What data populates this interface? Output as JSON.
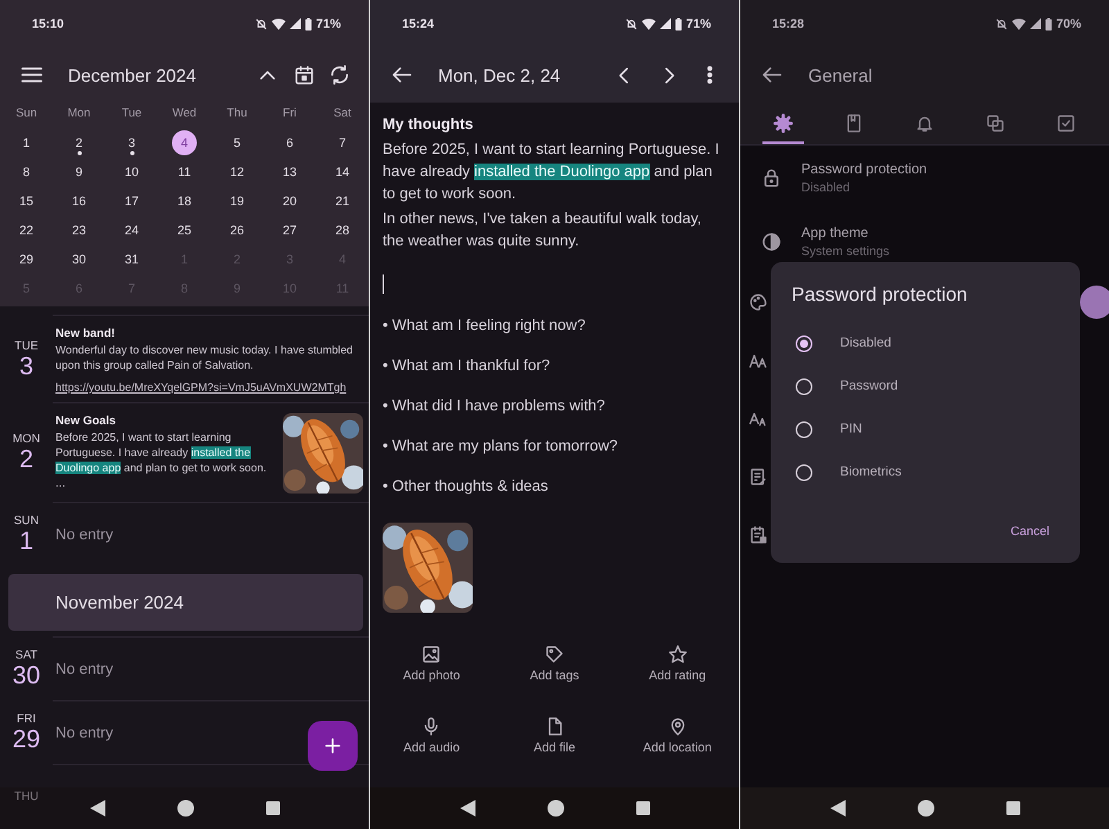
{
  "calendar_screen": {
    "status_bar": {
      "time": "15:10",
      "battery": "71%"
    },
    "title": "December 2024",
    "weekdays": [
      "Sun",
      "Mon",
      "Tue",
      "Wed",
      "Thu",
      "Fri",
      "Sat"
    ],
    "weeks": [
      [
        {
          "day": "1",
          "in_month": true,
          "selected": false,
          "has_entry": false
        },
        {
          "day": "2",
          "in_month": true,
          "selected": false,
          "has_entry": true
        },
        {
          "day": "3",
          "in_month": true,
          "selected": false,
          "has_entry": true
        },
        {
          "day": "4",
          "in_month": true,
          "selected": true,
          "has_entry": false
        },
        {
          "day": "5",
          "in_month": true,
          "selected": false,
          "has_entry": false
        },
        {
          "day": "6",
          "in_month": true,
          "selected": false,
          "has_entry": false
        },
        {
          "day": "7",
          "in_month": true,
          "selected": false,
          "has_entry": false
        }
      ],
      [
        {
          "day": "8",
          "in_month": true,
          "selected": false,
          "has_entry": false
        },
        {
          "day": "9",
          "in_month": true,
          "selected": false,
          "has_entry": false
        },
        {
          "day": "10",
          "in_month": true,
          "selected": false,
          "has_entry": false
        },
        {
          "day": "11",
          "in_month": true,
          "selected": false,
          "has_entry": false
        },
        {
          "day": "12",
          "in_month": true,
          "selected": false,
          "has_entry": false
        },
        {
          "day": "13",
          "in_month": true,
          "selected": false,
          "has_entry": false
        },
        {
          "day": "14",
          "in_month": true,
          "selected": false,
          "has_entry": false
        }
      ],
      [
        {
          "day": "15",
          "in_month": true,
          "selected": false,
          "has_entry": false
        },
        {
          "day": "16",
          "in_month": true,
          "selected": false,
          "has_entry": false
        },
        {
          "day": "17",
          "in_month": true,
          "selected": false,
          "has_entry": false
        },
        {
          "day": "18",
          "in_month": true,
          "selected": false,
          "has_entry": false
        },
        {
          "day": "19",
          "in_month": true,
          "selected": false,
          "has_entry": false
        },
        {
          "day": "20",
          "in_month": true,
          "selected": false,
          "has_entry": false
        },
        {
          "day": "21",
          "in_month": true,
          "selected": false,
          "has_entry": false
        }
      ],
      [
        {
          "day": "22",
          "in_month": true,
          "selected": false,
          "has_entry": false
        },
        {
          "day": "23",
          "in_month": true,
          "selected": false,
          "has_entry": false
        },
        {
          "day": "24",
          "in_month": true,
          "selected": false,
          "has_entry": false
        },
        {
          "day": "25",
          "in_month": true,
          "selected": false,
          "has_entry": false
        },
        {
          "day": "26",
          "in_month": true,
          "selected": false,
          "has_entry": false
        },
        {
          "day": "27",
          "in_month": true,
          "selected": false,
          "has_entry": false
        },
        {
          "day": "28",
          "in_month": true,
          "selected": false,
          "has_entry": false
        }
      ],
      [
        {
          "day": "29",
          "in_month": true,
          "selected": false,
          "has_entry": false
        },
        {
          "day": "30",
          "in_month": true,
          "selected": false,
          "has_entry": false
        },
        {
          "day": "31",
          "in_month": true,
          "selected": false,
          "has_entry": false
        },
        {
          "day": "1",
          "in_month": false,
          "selected": false,
          "has_entry": false
        },
        {
          "day": "2",
          "in_month": false,
          "selected": false,
          "has_entry": false
        },
        {
          "day": "3",
          "in_month": false,
          "selected": false,
          "has_entry": false
        },
        {
          "day": "4",
          "in_month": false,
          "selected": false,
          "has_entry": false
        }
      ],
      [
        {
          "day": "5",
          "in_month": false,
          "selected": false,
          "has_entry": false
        },
        {
          "day": "6",
          "in_month": false,
          "selected": false,
          "has_entry": false
        },
        {
          "day": "7",
          "in_month": false,
          "selected": false,
          "has_entry": false
        },
        {
          "day": "8",
          "in_month": false,
          "selected": false,
          "has_entry": false
        },
        {
          "day": "9",
          "in_month": false,
          "selected": false,
          "has_entry": false
        },
        {
          "day": "10",
          "in_month": false,
          "selected": false,
          "has_entry": false
        },
        {
          "day": "11",
          "in_month": false,
          "selected": false,
          "has_entry": false
        }
      ]
    ],
    "timeline": [
      {
        "kind": "entry",
        "weekday": "TUE",
        "date": "3",
        "title": "New band!",
        "text": [
          {
            "text": "Wonderful day to discover new music today. I have stumbled upon this group called Pain of Salvation.",
            "highlighted": false
          }
        ],
        "link": "https://youtu.be/MreXYqelGPM?si=VmJ5uAVmXUW2MTgh"
      },
      {
        "kind": "entry",
        "weekday": "MON",
        "date": "2",
        "title": "New Goals",
        "text": [
          {
            "text": "Before 2025, I want to start learning Portuguese. I have already ",
            "highlighted": false
          },
          {
            "text": "installed the Duolingo app",
            "highlighted": true
          },
          {
            "text": " and plan to get to work soon.",
            "highlighted": false
          }
        ],
        "more": "...",
        "photo": {
          "kind": "picture"
        }
      },
      {
        "kind": "empty",
        "weekday": "SUN",
        "date": "1",
        "text": "No entry"
      },
      {
        "kind": "month",
        "label": "November 2024"
      },
      {
        "kind": "empty",
        "weekday": "SAT",
        "date": "30",
        "text": "No entry"
      },
      {
        "kind": "empty",
        "weekday": "FRI",
        "date": "29",
        "text": "No entry"
      },
      {
        "kind": "empty",
        "weekday": "THU"
      }
    ]
  },
  "entry_screen": {
    "status_bar": {
      "time": "15:24",
      "battery": "71%"
    },
    "title": "Mon, Dec 2, 24",
    "note": {
      "title": "My thoughts",
      "paragraphs": [
        {
          "parts": [
            {
              "text": "Before 2025, I want to start learning Portuguese. I have already ",
              "highlighted": false
            },
            {
              "text": "installed the Duolingo app",
              "highlighted": true
            },
            {
              "text": " and plan to get to work soon.",
              "highlighted": false
            }
          ]
        },
        {
          "parts": [
            {
              "text": "In other news, I've taken a beautiful walk today, the weather was quite sunny.",
              "highlighted": false
            }
          ]
        }
      ],
      "prompts": [
        "• What am I feeling right now?",
        "• What am I thankful for?",
        "• What did I have problems with?",
        "• What are my plans for tomorrow?",
        "• Other thoughts & ideas"
      ]
    },
    "attachment": {
      "kind": "picture"
    },
    "actions": [
      {
        "label": "Add photo"
      },
      {
        "label": "Add tags"
      },
      {
        "label": "Add rating"
      },
      {
        "label": "Add audio"
      },
      {
        "label": "Add file"
      },
      {
        "label": "Add location"
      }
    ]
  },
  "settings_screen": {
    "status_bar": {
      "time": "15:28",
      "battery": "70%"
    },
    "title": "General",
    "tabs": [
      {
        "selected": true
      },
      {
        "selected": false
      },
      {
        "selected": false
      },
      {
        "selected": false
      },
      {
        "selected": false
      }
    ],
    "settings": [
      {
        "title": "Password protection",
        "value": "Disabled"
      },
      {
        "title": "App theme",
        "value": "System settings"
      }
    ],
    "dialog": {
      "title": "Password protection",
      "options": [
        {
          "label": "Disabled",
          "selected": true
        },
        {
          "label": "Password",
          "selected": false
        },
        {
          "label": "PIN",
          "selected": false
        },
        {
          "label": "Biometrics",
          "selected": false
        }
      ],
      "button": "Cancel"
    }
  }
}
